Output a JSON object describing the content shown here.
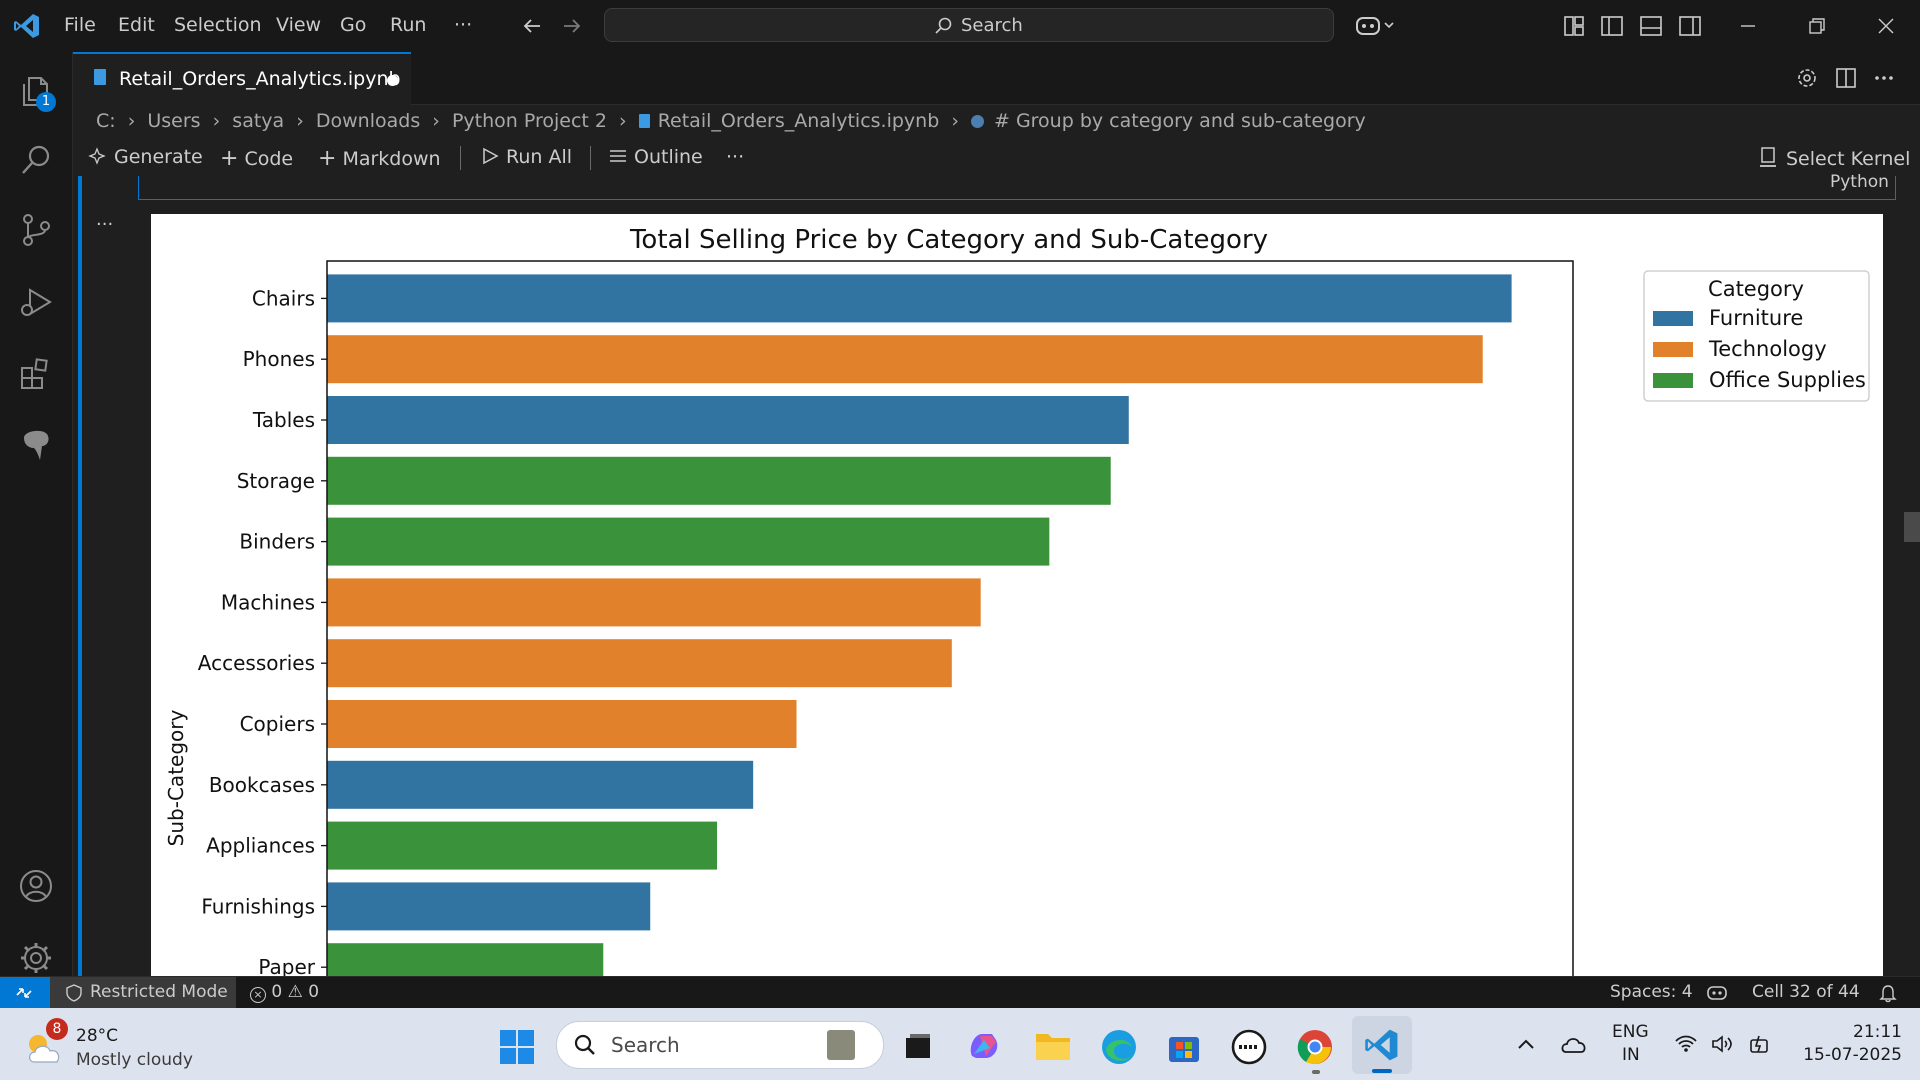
{
  "menu": [
    "File",
    "Edit",
    "Selection",
    "View",
    "Go",
    "Run",
    "···"
  ],
  "search": {
    "label": "Search"
  },
  "tab": {
    "title": "Retail_Orders_Analytics.ipynb"
  },
  "breadcrumb": [
    "C:",
    "Users",
    "satya",
    "Downloads",
    "Python Project 2",
    "Retail_Orders_Analytics.ipynb",
    "# Group by category and sub-category"
  ],
  "toolbar": {
    "generate": "Generate",
    "code": "Code",
    "markdown": "Markdown",
    "run_all": "Run All",
    "outline": "Outline",
    "more": "···",
    "select_kernel": "Select Kernel",
    "kernel_lang": "Python"
  },
  "cell": {
    "more": "···"
  },
  "activity": {
    "explorer_badge": "1"
  },
  "chart_data": {
    "type": "bar",
    "orientation": "horizontal",
    "title": "Total Selling Price by Category and Sub-Category",
    "xlabel": "",
    "ylabel": "Sub-Category",
    "xlim": [
      0,
      345000
    ],
    "legend": {
      "title": "Category",
      "position": "top-right",
      "entries": [
        {
          "name": "Furniture",
          "color": "#3274a1"
        },
        {
          "name": "Technology",
          "color": "#e1812c"
        },
        {
          "name": "Office Supplies",
          "color": "#3a923a"
        }
      ]
    },
    "categories": [
      "Chairs",
      "Phones",
      "Tables",
      "Storage",
      "Binders",
      "Machines",
      "Accessories",
      "Copiers",
      "Bookcases",
      "Appliances",
      "Furnishings",
      "Paper"
    ],
    "values": [
      328000,
      320000,
      222000,
      217000,
      200000,
      181000,
      173000,
      130000,
      118000,
      108000,
      89500,
      76500
    ],
    "category_group": [
      "Furniture",
      "Technology",
      "Furniture",
      "Office Supplies",
      "Office Supplies",
      "Technology",
      "Technology",
      "Technology",
      "Furniture",
      "Office Supplies",
      "Furniture",
      "Office Supplies"
    ]
  },
  "status": {
    "restricted": "Restricted Mode",
    "errors": "0",
    "warnings": "0",
    "spaces": "Spaces: 4",
    "cell": "Cell 32 of 44"
  },
  "taskbar": {
    "weather_badge": "8",
    "temp": "28°C",
    "weather": "Mostly cloudy",
    "search": "Search",
    "lang1": "ENG",
    "lang2": "IN",
    "time": "21:11",
    "date": "15-07-2025"
  }
}
